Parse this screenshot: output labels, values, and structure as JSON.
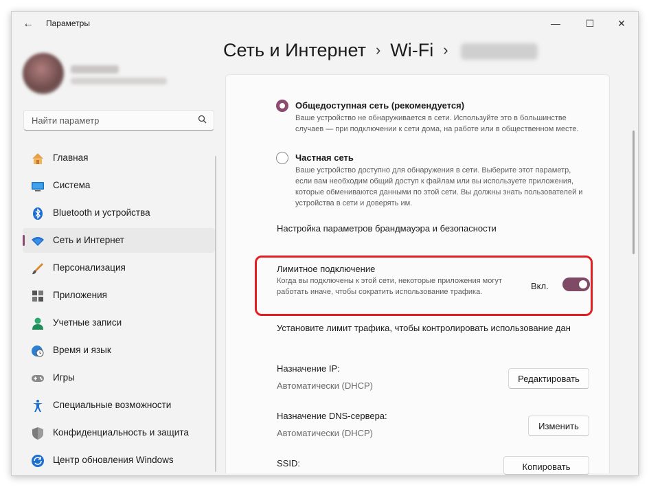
{
  "window": {
    "title": "Параметры"
  },
  "controls": {
    "minimize": "—",
    "maximize": "☐",
    "close": "✕",
    "back": "←"
  },
  "search": {
    "placeholder": "Найти параметр",
    "value": ""
  },
  "sidebar": {
    "items": [
      {
        "label": "Главная",
        "icon": "home-icon",
        "active": false
      },
      {
        "label": "Система",
        "icon": "display-icon",
        "active": false
      },
      {
        "label": "Bluetooth и устройства",
        "icon": "bluetooth-icon",
        "active": false
      },
      {
        "label": "Сеть и Интернет",
        "icon": "wifi-icon",
        "active": true
      },
      {
        "label": "Персонализация",
        "icon": "brush-icon",
        "active": false
      },
      {
        "label": "Приложения",
        "icon": "apps-icon",
        "active": false
      },
      {
        "label": "Учетные записи",
        "icon": "person-icon",
        "active": false
      },
      {
        "label": "Время и язык",
        "icon": "globe-clock-icon",
        "active": false
      },
      {
        "label": "Игры",
        "icon": "gamepad-icon",
        "active": false
      },
      {
        "label": "Специальные возможности",
        "icon": "accessibility-icon",
        "active": false
      },
      {
        "label": "Конфиденциальность и защита",
        "icon": "shield-icon",
        "active": false
      },
      {
        "label": "Центр обновления Windows",
        "icon": "update-icon",
        "active": false
      }
    ]
  },
  "breadcrumb": {
    "part1": "Сеть и Интернет",
    "part2": "Wi-Fi",
    "sep": "›"
  },
  "profile_type": {
    "public": {
      "title": "Общедоступная сеть (рекомендуется)",
      "desc": "Ваше устройство не обнаруживается в сети. Используйте это в большинстве случаев — при подключении к сети дома, на работе или в общественном месте.",
      "checked": true
    },
    "private": {
      "title": "Частная сеть",
      "desc": "Ваше устройство доступно для обнаружения в сети. Выберите этот параметр, если вам необходим общий доступ к файлам или вы используете приложения, которые обмениваются данными по этой сети. Вы должны знать пользователей и устройства в сети и доверять им.",
      "checked": false
    }
  },
  "firewall_link": "Настройка параметров брандмауэра и безопасности",
  "metered": {
    "title": "Лимитное подключение",
    "desc": "Когда вы подключены к этой сети, некоторые приложения могут работать иначе, чтобы сократить использование трафика.",
    "toggle_label": "Вкл.",
    "on": true
  },
  "data_limit_link": "Установите лимит трафика, чтобы контролировать использование дан",
  "ip": {
    "label": "Назначение IP:",
    "value": "Автоматически (DHCP)",
    "button": "Редактировать"
  },
  "dns": {
    "label": "Назначение DNS-сервера:",
    "value": "Автоматически (DHCP)",
    "button": "Изменить"
  },
  "ssid": {
    "label": "SSID:",
    "button": "Копировать"
  },
  "colors": {
    "accent": "#8e4a6e",
    "highlight": "#e02020",
    "toggle_on": "#7e4a66"
  }
}
